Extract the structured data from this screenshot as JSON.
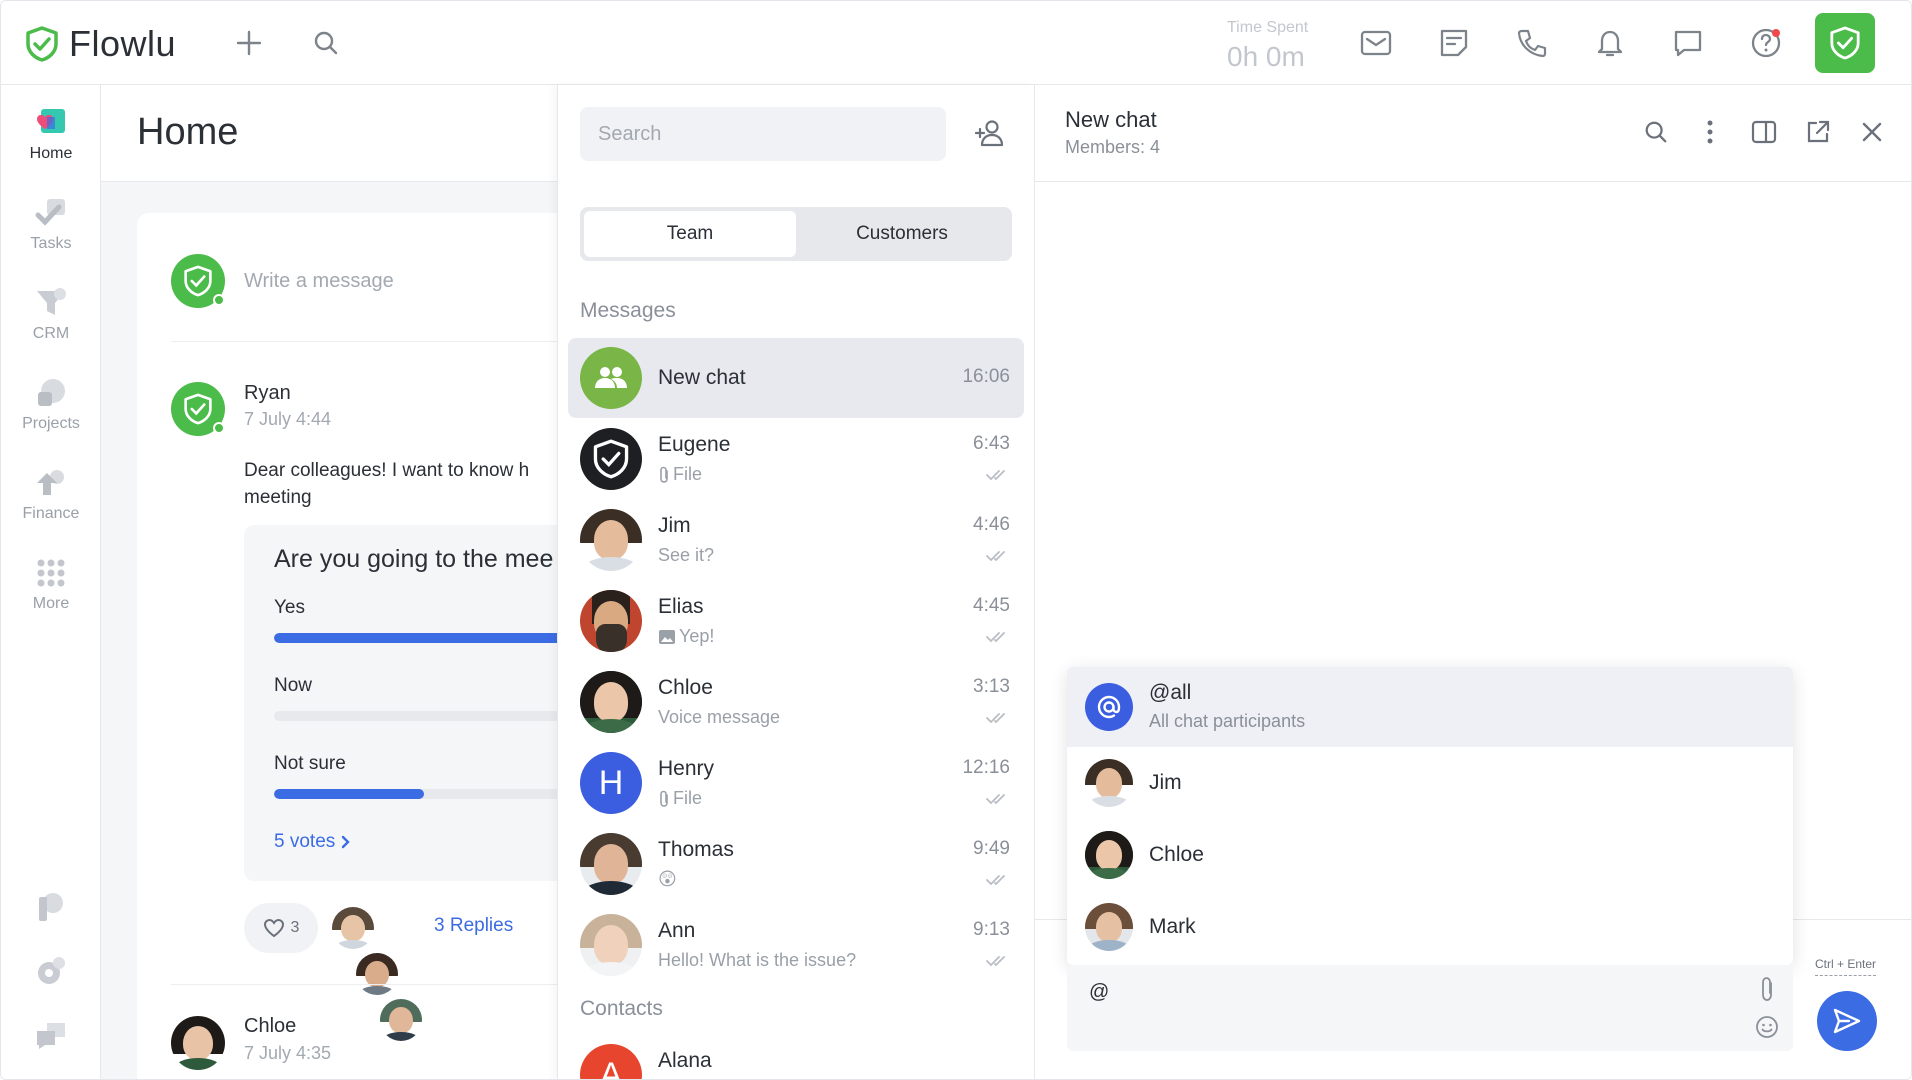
{
  "app": {
    "brand": "Flowlu",
    "accent": "#4bbb4a",
    "link_color": "#3b6ce3"
  },
  "topbar": {
    "icons": [
      "plus-icon",
      "search-icon",
      "mail-icon",
      "notes-icon",
      "phone-icon",
      "bell-icon",
      "chat-icon",
      "help-icon",
      "flowlu-check-icon"
    ],
    "time_spent_label": "Time Spent",
    "time_spent_value": "0h 0m"
  },
  "sidebar": {
    "items": [
      {
        "label": "Home",
        "icon": "home-icon",
        "active": true
      },
      {
        "label": "Tasks",
        "icon": "tasks-icon"
      },
      {
        "label": "CRM",
        "icon": "crm-icon"
      },
      {
        "label": "Projects",
        "icon": "projects-icon"
      },
      {
        "label": "Finance",
        "icon": "finance-icon"
      },
      {
        "label": "More",
        "icon": "more-grid-icon"
      }
    ],
    "bottom_icons": [
      "pin-icon",
      "settings-icon",
      "feedback-icon"
    ]
  },
  "home": {
    "title": "Home",
    "composer_placeholder": "Write a message",
    "post": {
      "author": "Ryan",
      "date": "7 July 4:44",
      "text_line1": "Dear colleagues! I want to know h",
      "text_line2": "meeting",
      "poll": {
        "question": "Are you going to the mee",
        "options": [
          {
            "label": "Yes",
            "share": 1.0
          },
          {
            "label": "Now",
            "share": 0.0
          },
          {
            "label": "Not sure",
            "share": 0.47
          }
        ],
        "votes": "5 votes"
      },
      "likes": "3",
      "replies": "3 Replies"
    },
    "next_post": {
      "author": "Chloe",
      "date": "7 July 4:35"
    }
  },
  "chatlist": {
    "search_placeholder": "Search",
    "tabs": [
      "Team",
      "Customers"
    ],
    "messages_heading": "Messages",
    "contacts_heading": "Contacts",
    "chats": [
      {
        "name": "New chat",
        "time": "16:06",
        "preview": ""
      },
      {
        "name": "Eugene",
        "time": "6:43",
        "preview": "File"
      },
      {
        "name": "Jim",
        "time": "4:46",
        "preview": "See it?"
      },
      {
        "name": "Elias",
        "time": "4:45",
        "preview": "Yep!"
      },
      {
        "name": "Chloe",
        "time": "3:13",
        "preview": "Voice message"
      },
      {
        "name": "Henry",
        "time": "12:16",
        "preview": "File",
        "initial": "H"
      },
      {
        "name": "Thomas",
        "time": "9:49",
        "preview": "😲"
      },
      {
        "name": "Ann",
        "time": "9:13",
        "preview": "Hello! What is the issue?"
      }
    ],
    "contacts": [
      {
        "name": "Alana",
        "initial": "A"
      }
    ]
  },
  "conversation": {
    "title": "New chat",
    "members": "Members: 4",
    "mentions": [
      {
        "name": "@all",
        "sub": "All chat participants"
      },
      {
        "name": "Jim"
      },
      {
        "name": "Chloe"
      },
      {
        "name": "Mark"
      }
    ],
    "input_value": "@",
    "send_hint": "Ctrl + Enter"
  }
}
